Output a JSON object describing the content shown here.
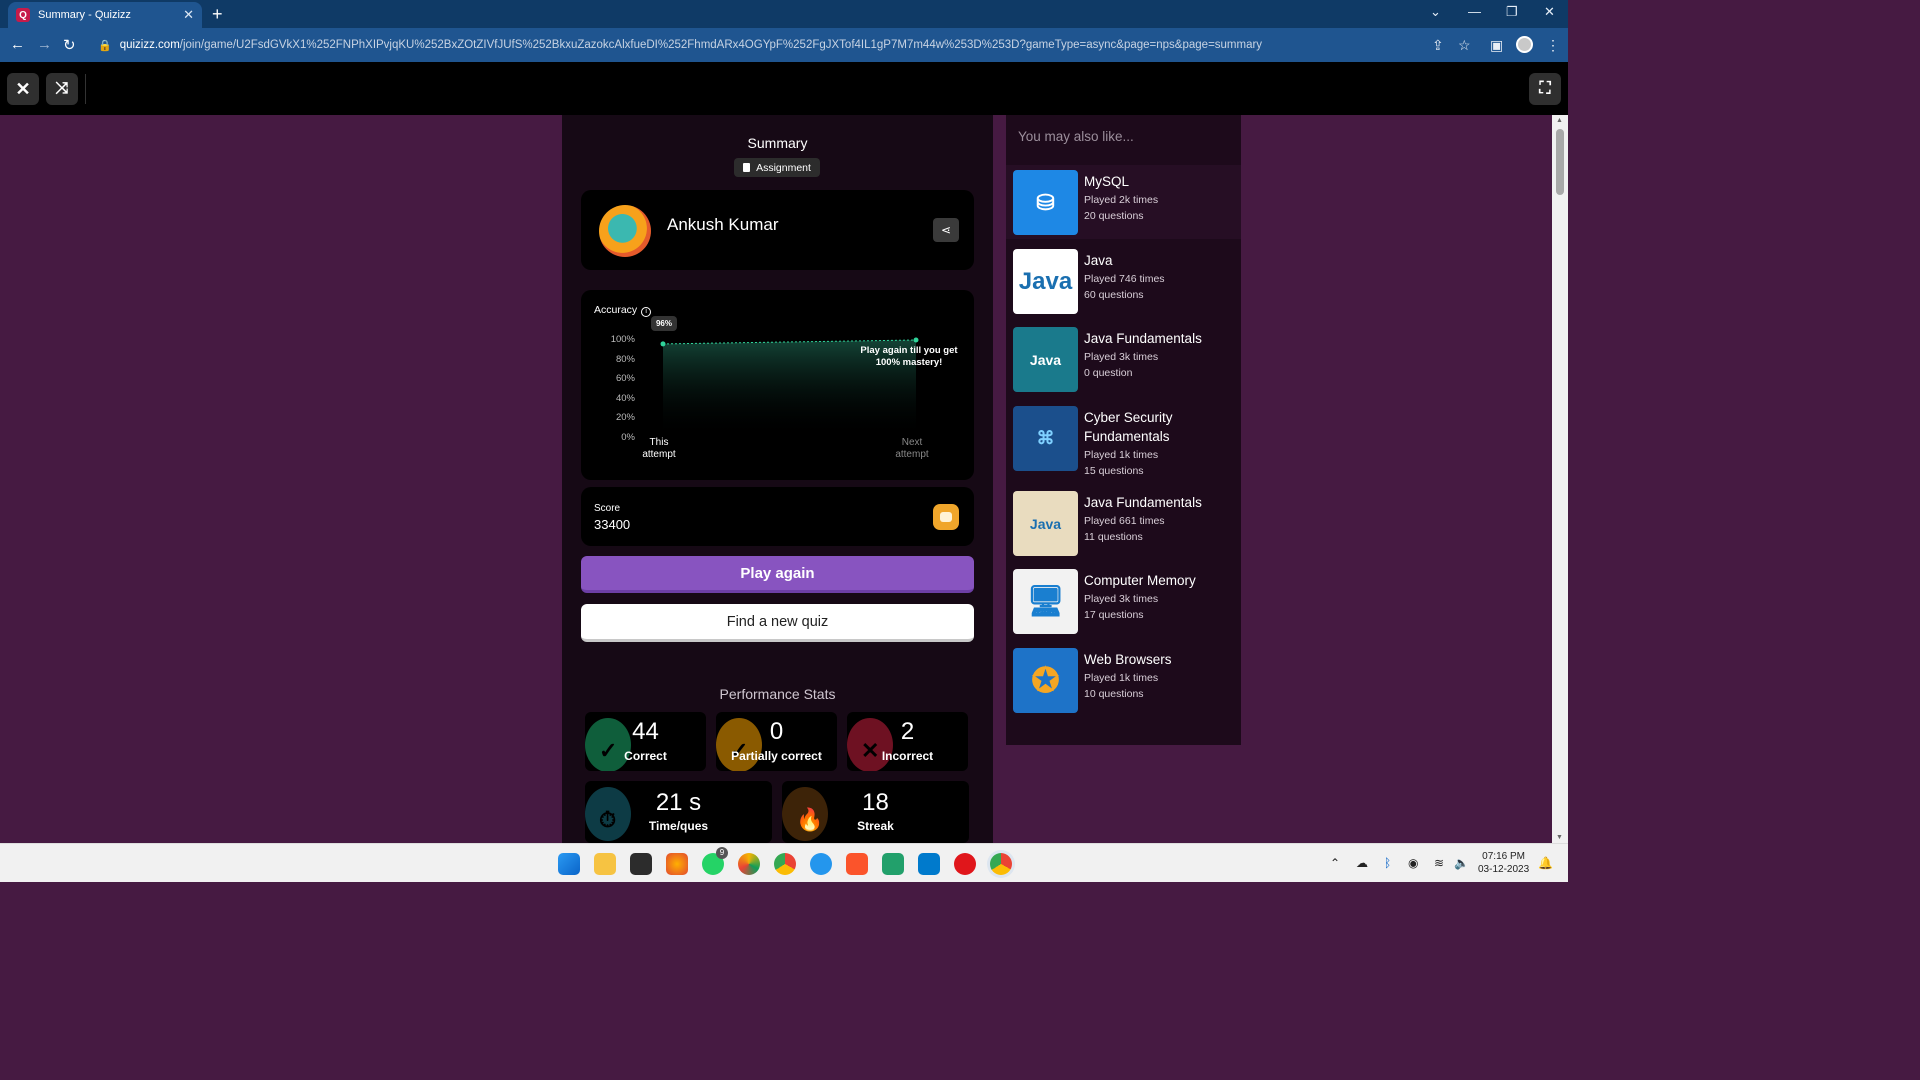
{
  "browser": {
    "tab_title": "Summary - Quizizz",
    "favicon_letter": "Q",
    "new_tab": "+",
    "url_domain": "quizizz.com",
    "url_rest": "/join/game/U2FsdGVkX1%252FNPhXIPvjqKU%252BxZOtZIVfJUfS%252BkxuZazokcAlxfueDI%252FhmdARx4OGYpF%252FgJXTof4IL1gP7M7m44w%253D%253D?gameType=async&page=nps&page=summary"
  },
  "summary": {
    "title": "Summary",
    "assignment_label": "Assignment"
  },
  "profile": {
    "name": "Ankush Kumar"
  },
  "accuracy": {
    "label": "Accuracy",
    "bubble": "96%",
    "mastery_text": "Play again till you get 100% mastery!",
    "y_ticks": [
      "100%",
      "80%",
      "60%",
      "40%",
      "20%",
      "0%"
    ],
    "x_label_this": "This attempt",
    "x_label_next": "Next attempt",
    "chart_data": {
      "type": "area",
      "categories": [
        "This attempt",
        "Next attempt"
      ],
      "values": [
        96,
        100
      ],
      "ylim": [
        0,
        100
      ],
      "ylabel": "Accuracy",
      "accent_color": "#2fd39a"
    }
  },
  "score": {
    "label": "Score",
    "value": "33400"
  },
  "buttons": {
    "play_again": "Play again",
    "find_new": "Find a new quiz"
  },
  "performance": {
    "title": "Performance Stats",
    "stats": [
      {
        "value": "44",
        "label": "Correct",
        "color": "#0f5e3b",
        "glyph": "✓"
      },
      {
        "value": "0",
        "label": "Partially correct",
        "color": "#8a5a00",
        "glyph": "✓"
      },
      {
        "value": "2",
        "label": "Incorrect",
        "color": "#6e1122",
        "glyph": "✕"
      },
      {
        "value": "21 s",
        "label": "Time/ques",
        "color": "#0d3b45",
        "glyph": "⏱"
      },
      {
        "value": "18",
        "label": "Streak",
        "color": "#3d2308",
        "glyph": "🔥"
      }
    ]
  },
  "sidebar": {
    "title": "You may also like...",
    "items": [
      {
        "name": "MySQL",
        "played": "Played 2k times",
        "questions": "20 questions",
        "thumb_color": "#1e88e5"
      },
      {
        "name": "Java",
        "played": "Played 746 times",
        "questions": "60 questions",
        "thumb_color": "#ffffff"
      },
      {
        "name": "Java Fundamentals",
        "played": "Played 3k times",
        "questions": "0 question",
        "thumb_color": "#1a7a8c"
      },
      {
        "name": "Cyber Security Fundamentals",
        "played": "Played 1k times",
        "questions": "15 questions",
        "thumb_color": "#1b4f8c"
      },
      {
        "name": "Java Fundamentals",
        "played": "Played 661 times",
        "questions": "11 questions",
        "thumb_color": "#e9dcbf"
      },
      {
        "name": "Computer Memory",
        "played": "Played 3k times",
        "questions": "17 questions",
        "thumb_color": "#f2f2f2"
      },
      {
        "name": "Web Browsers",
        "played": "Played 1k times",
        "questions": "10 questions",
        "thumb_color": "#1e73c8"
      }
    ]
  },
  "taskbar": {
    "time": "07:16 PM",
    "date": "03-12-2023",
    "badge": "9"
  }
}
